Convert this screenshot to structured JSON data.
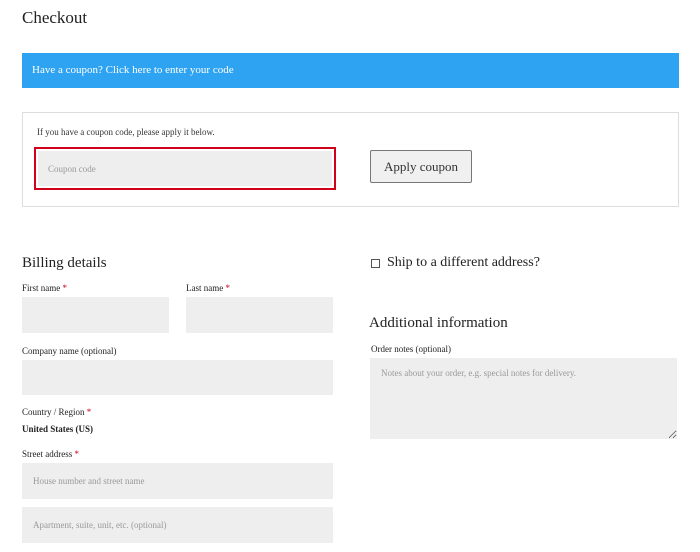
{
  "page": {
    "title": "Checkout"
  },
  "coupon": {
    "banner_text": "Have a coupon? Click here to enter your code",
    "hint": "If you have a coupon code, please apply it below.",
    "placeholder": "Coupon code",
    "button_label": "Apply coupon",
    "highlight_color": "#d0021b"
  },
  "billing": {
    "title": "Billing details",
    "required_mark": "*",
    "first_name_label": "First name",
    "last_name_label": "Last name",
    "company_label": "Company name (optional)",
    "country_label": "Country / Region",
    "country_value": "United States (US)",
    "street_label": "Street address",
    "street_placeholder_1": "House number and street name",
    "street_placeholder_2": "Apartment, suite, unit, etc. (optional)"
  },
  "shipping": {
    "ship_label": "Ship to a different address?",
    "checked": false
  },
  "additional": {
    "title": "Additional information",
    "notes_label": "Order notes (optional)",
    "notes_placeholder": "Notes about your order, e.g. special notes for delivery."
  },
  "colors": {
    "banner": "#2ea3f2",
    "field_bg": "#eeeeee",
    "required": "#d0021b"
  }
}
